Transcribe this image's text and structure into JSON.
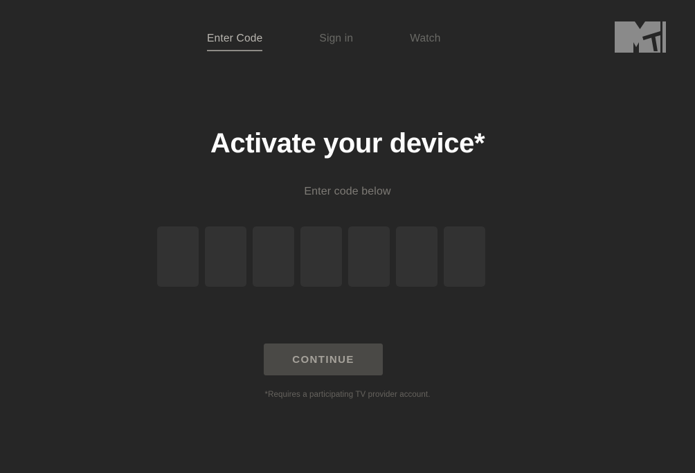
{
  "theme": {
    "background": "#262626",
    "box_fill": "#323232",
    "button_fill": "#4a4946",
    "button_text": "#a6a29b",
    "title_color": "#fdfdfd",
    "muted_text": "#7d7a75",
    "nav_active": "#b9b6b0",
    "nav_inactive": "#6a6a66",
    "logo_color": "#8a8a8a"
  },
  "header": {
    "nav": [
      {
        "label": "Enter Code",
        "active": true
      },
      {
        "label": "Sign in",
        "active": false
      },
      {
        "label": "Watch",
        "active": false
      }
    ],
    "logo": {
      "name": "mtv-logo",
      "alt": "MTV"
    }
  },
  "main": {
    "title": "Activate your device*",
    "subtitle": "Enter code below",
    "code_input": {
      "length": 7,
      "values": [
        "",
        "",
        "",
        "",
        "",
        "",
        ""
      ],
      "placeholder": ""
    },
    "continue_label": "CONTINUE",
    "footnote": "*Requires a participating TV provider account."
  }
}
